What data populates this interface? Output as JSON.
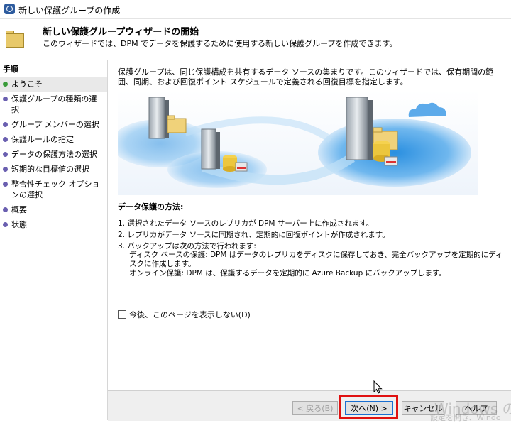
{
  "window": {
    "title": "新しい保護グループの作成"
  },
  "header": {
    "title": "新しい保護グループウィザードの開始",
    "subtitle": "このウィザードでは、DPM でデータを保護するために使用する新しい保護グループを作成できます。"
  },
  "steps": {
    "heading": "手順",
    "items": [
      "ようこそ",
      "保護グループの種類の選択",
      "グループ メンバーの選択",
      "保護ルールの指定",
      "データの保護方法の選択",
      "短期的な目標値の選択",
      "整合性チェック オプションの選択",
      "概要",
      "状態"
    ]
  },
  "content": {
    "intro": "保護グループは、同じ保護構成を共有するデータ ソースの集まりです。このウィザードでは、保有期間の範囲、同期、および回復ポイント スケジュールで定義される回復目標を指定します。",
    "method_title": "データ保護の方法:",
    "m1": "1. 選択されたデータ ソースのレプリカが DPM サーバー上に作成されます。",
    "m2": "2. レプリカがデータ ソースに同期され、定期的に回復ポイントが作成されます。",
    "m3": "3. バックアップは次の方法で行われます:",
    "m3a": "ディスク ベースの保護: DPM はデータのレプリカをディスクに保存しておき、完全バックアップを定期的にディスクに作成します。",
    "m3b": "オンライン保護: DPM は、保護するデータを定期的に Azure Backup にバックアップします。",
    "checkbox": "今後、このページを表示しない(D)"
  },
  "buttons": {
    "back": "< 戻る(B)",
    "next": "次へ(N) >",
    "cancel": "キャンセル",
    "help": "ヘルプ"
  },
  "watermark": {
    "line1": "Windows のライ",
    "line2": "設定を開き、Windo"
  },
  "colors": {
    "highlight": "#e01010",
    "accent_blue": "#1a6fd1"
  }
}
